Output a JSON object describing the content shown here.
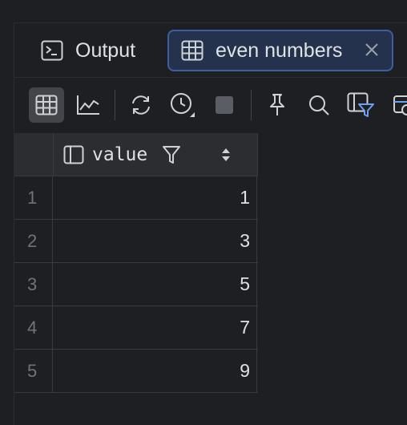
{
  "tabs": [
    {
      "label": "Output",
      "icon": "console-icon",
      "active": false
    },
    {
      "label": "even numbers",
      "icon": "table-icon",
      "active": true
    }
  ],
  "toolbar": {
    "buttons": [
      "table-view-icon",
      "chart-view-icon",
      "refresh-icon",
      "history-icon",
      "stop-icon",
      "pin-icon",
      "search-icon",
      "filter-columns-icon",
      "more-icon"
    ]
  },
  "table": {
    "column": "value",
    "rows": [
      {
        "num": "1",
        "value": "1"
      },
      {
        "num": "2",
        "value": "3"
      },
      {
        "num": "3",
        "value": "5"
      },
      {
        "num": "4",
        "value": "7"
      },
      {
        "num": "5",
        "value": "9"
      }
    ]
  },
  "colors": {
    "accent": "#3d5ea0",
    "active_tab_bg": "#25324d",
    "background": "#1e1f22"
  }
}
